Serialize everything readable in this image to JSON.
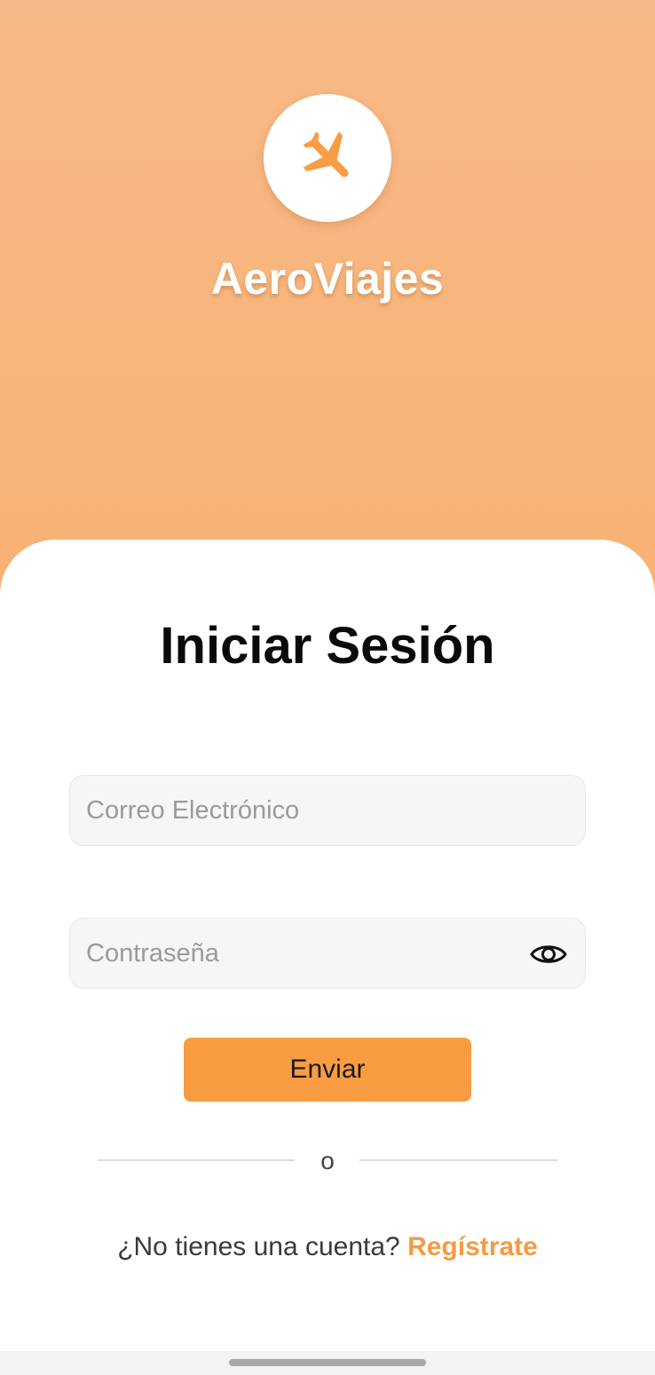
{
  "app": {
    "name": "AeroViajes",
    "logo_icon": "airplane-icon",
    "brand_color": "#f99c42"
  },
  "login": {
    "title": "Iniciar Sesión",
    "email_placeholder": "Correo Electrónico",
    "password_placeholder": "Contraseña",
    "password_toggle_icon": "eye-icon",
    "submit_label": "Enviar",
    "divider_text": "o",
    "signup_prompt": "¿No tienes una cuenta?",
    "signup_link": "Regístrate"
  }
}
